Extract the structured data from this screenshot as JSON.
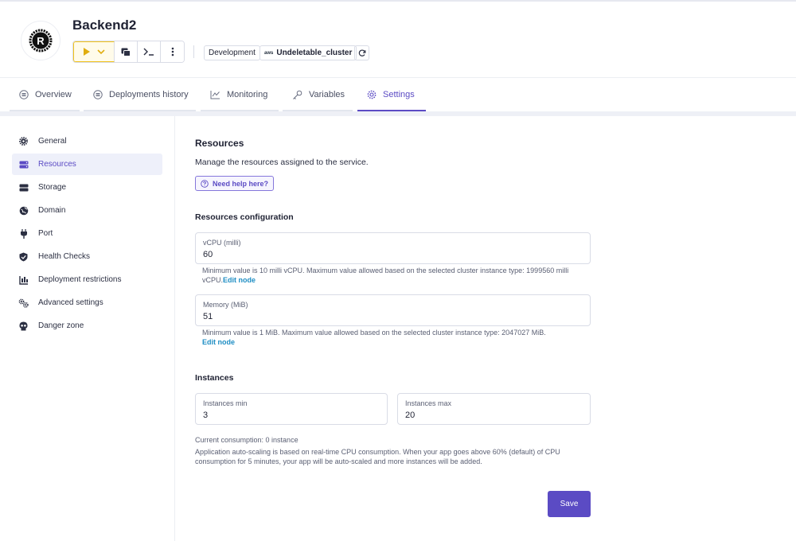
{
  "header": {
    "title": "Backend2",
    "environment_tag": "Development",
    "cluster_tag": "Undeletable_cluster",
    "cluster_provider": "aws",
    "play_color": "#f1c21b"
  },
  "tabs": [
    {
      "label": "Overview",
      "icon": "list-icon"
    },
    {
      "label": "Deployments history",
      "icon": "list-icon"
    },
    {
      "label": "Monitoring",
      "icon": "chart-line-icon"
    },
    {
      "label": "Variables",
      "icon": "key-icon"
    },
    {
      "label": "Settings",
      "icon": "gear-icon",
      "active": true
    }
  ],
  "sidebar": {
    "items": [
      {
        "label": "General",
        "icon": "gear-icon"
      },
      {
        "label": "Resources",
        "icon": "server-icon",
        "active": true
      },
      {
        "label": "Storage",
        "icon": "database-icon"
      },
      {
        "label": "Domain",
        "icon": "globe-icon"
      },
      {
        "label": "Port",
        "icon": "plug-icon"
      },
      {
        "label": "Health Checks",
        "icon": "shield-check-icon"
      },
      {
        "label": "Deployment restrictions",
        "icon": "restriction-icon"
      },
      {
        "label": "Advanced settings",
        "icon": "gears-icon"
      },
      {
        "label": "Danger zone",
        "icon": "skull-icon"
      }
    ]
  },
  "main": {
    "title": "Resources",
    "description": "Manage the resources assigned to the service.",
    "help_label": "Need help here?",
    "config_title": "Resources configuration",
    "vcpu": {
      "label": "vCPU (milli)",
      "value": "60",
      "hint": "Minimum value is 10 milli vCPU. Maximum value allowed based on the selected cluster instance type: 1999560 milli vCPU.",
      "link": "Edit node"
    },
    "memory": {
      "label": "Memory (MiB)",
      "value": "51",
      "hint": "Minimum value is 1 MiB. Maximum value allowed based on the selected cluster instance type: 2047027 MiB.",
      "link": "Edit node"
    },
    "instances_title": "Instances",
    "instances_min": {
      "label": "Instances min",
      "value": "3"
    },
    "instances_max": {
      "label": "Instances max",
      "value": "20"
    },
    "consumption": "Current consumption: 0 instance",
    "autoscaling_note": "Application auto-scaling is based on real-time CPU consumption. When your app goes above 60% (default) of CPU consumption for 5 minutes, your app will be auto-scaled and more instances will be added.",
    "save_label": "Save",
    "accent_color": "#5b4bc4"
  }
}
